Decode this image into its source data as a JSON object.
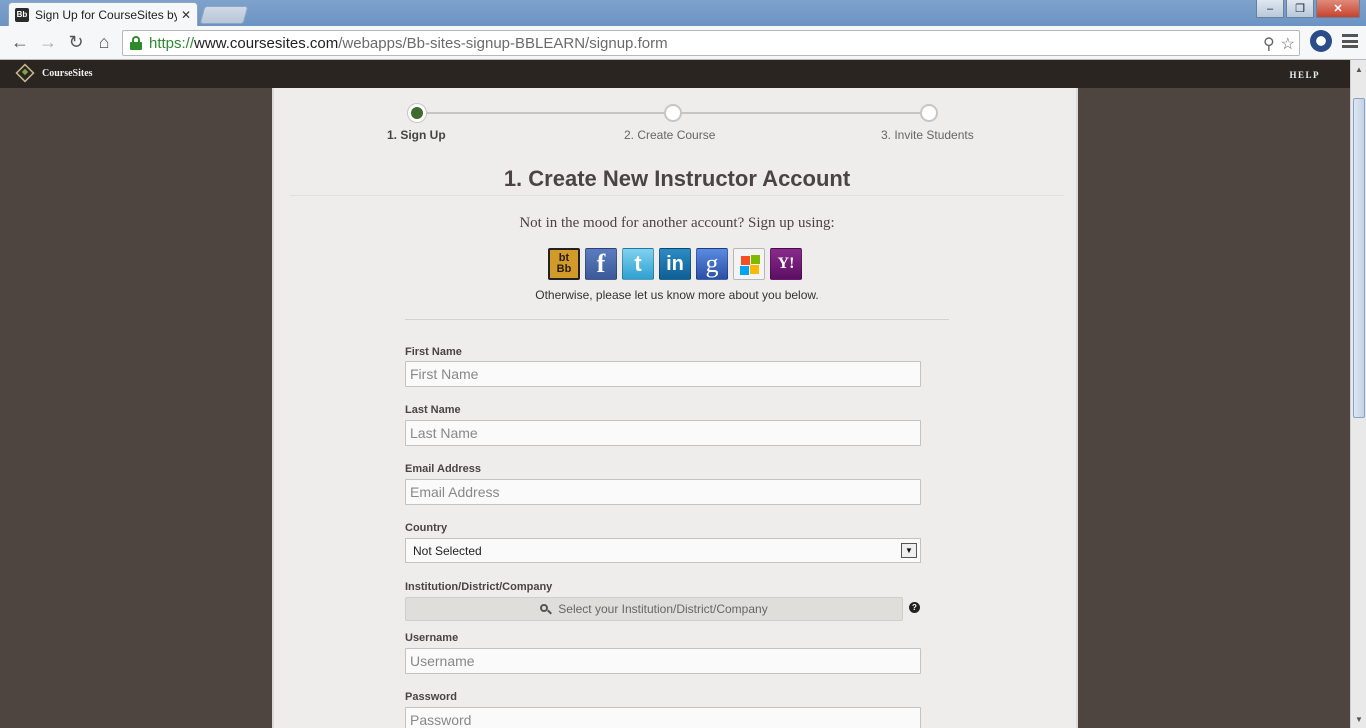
{
  "browser": {
    "tab_title": "Sign Up for CourseSites by",
    "tab_favicon_text": "Bb",
    "url_scheme": "https://",
    "url_host": "www.coursesites.com",
    "url_path": "/webapps/Bb-sites-signup-BBLEARN/signup.form",
    "win_minimize": "–",
    "win_maximize": "❐",
    "win_close": "✕",
    "icons": [
      "back-icon",
      "forward-icon",
      "reload-icon",
      "home-icon",
      "lock-icon",
      "zoom-icon",
      "star-icon",
      "extension-icon",
      "menu-icon"
    ]
  },
  "site": {
    "logo_text": "CourseSites",
    "help_label": "HELP"
  },
  "progress": {
    "steps": [
      {
        "label": "1. Sign Up",
        "active": true
      },
      {
        "label": "2. Create Course",
        "active": false
      },
      {
        "label": "3. Invite Students",
        "active": false
      }
    ]
  },
  "page": {
    "title": "1. Create New Instructor Account",
    "social_prompt": "Not in the mood for another account? Sign up using:",
    "social_sub": "Otherwise, please let us know more about you below.",
    "social_providers": [
      {
        "name": "blackboard",
        "label_top": "bt",
        "label_bottom": "Bb"
      },
      {
        "name": "facebook",
        "label": "f",
        "color": "#3b5998"
      },
      {
        "name": "twitter",
        "label": "t",
        "color": "#2fa0d3"
      },
      {
        "name": "linkedin",
        "label": "in",
        "color": "#0e5f95"
      },
      {
        "name": "google",
        "label": "g",
        "color": "#2c4fa8"
      },
      {
        "name": "windows-live",
        "label": ""
      },
      {
        "name": "yahoo",
        "label": "Y!",
        "color": "#5b0f63"
      }
    ]
  },
  "form": {
    "first_name": {
      "label": "First Name",
      "placeholder": "First Name",
      "value": ""
    },
    "last_name": {
      "label": "Last Name",
      "placeholder": "Last Name",
      "value": ""
    },
    "email": {
      "label": "Email Address",
      "placeholder": "Email Address",
      "value": ""
    },
    "country": {
      "label": "Country",
      "selected": "Not Selected",
      "arrow": "▼"
    },
    "institution": {
      "label": "Institution/District/Company",
      "button_label": "Select your Institution/District/Company",
      "help_glyph": "?"
    },
    "username": {
      "label": "Username",
      "placeholder": "Username",
      "value": ""
    },
    "password": {
      "label": "Password",
      "placeholder": "Password",
      "value": ""
    }
  }
}
